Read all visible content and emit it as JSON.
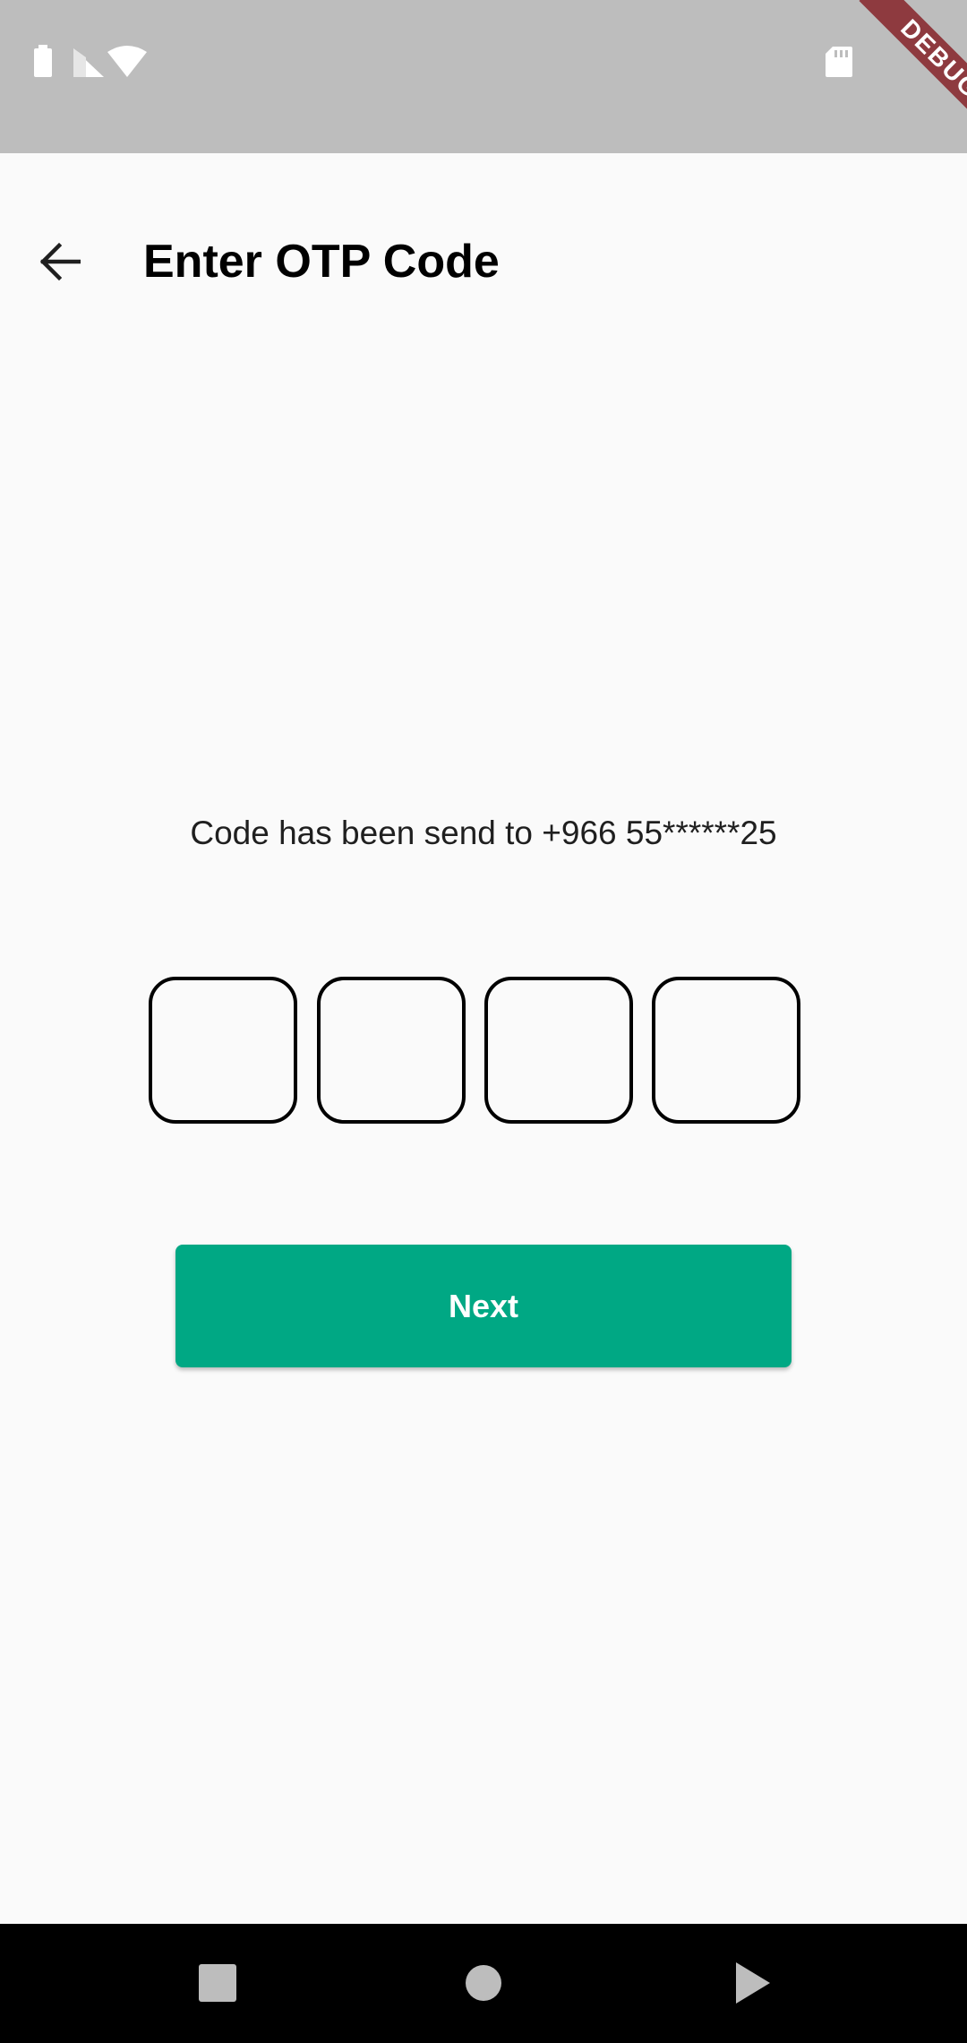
{
  "status_bar": {
    "icons": [
      "battery-icon",
      "signal-icon",
      "wifi-icon",
      "sd-card-icon"
    ],
    "debug_banner": "DEBUG",
    "background": "#bdbdbd",
    "banner_color": "#8e3a3f"
  },
  "app_bar": {
    "back_icon": "arrow-back-icon",
    "title": "Enter OTP Code"
  },
  "otp": {
    "message": "Code has been send to +966 55******25",
    "digits": [
      "",
      "",
      "",
      ""
    ]
  },
  "actions": {
    "next_label": "Next",
    "accent_color": "#00a884"
  },
  "nav_bar": {
    "icons": [
      "recents-icon",
      "home-icon",
      "back-triangle-icon"
    ]
  }
}
